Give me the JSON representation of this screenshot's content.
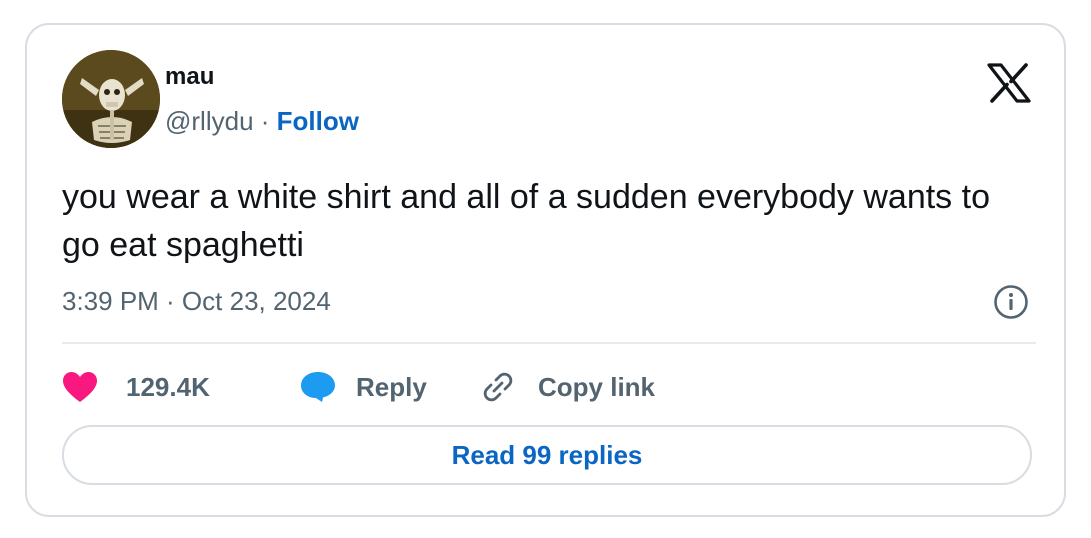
{
  "author": {
    "name": "mau",
    "handle": "@rllydu",
    "separator": "·",
    "follow_label": "Follow"
  },
  "post": {
    "text": "you wear a white shirt and all of a sudden everybody wants to go eat spaghetti",
    "timestamp": "3:39 PM · Oct 23, 2024"
  },
  "actions": {
    "likes": "129.4K",
    "reply_label": "Reply",
    "copy_label": "Copy link"
  },
  "footer": {
    "read_replies_label": "Read 99 replies"
  },
  "icons": {
    "logo": "x-logo-icon",
    "info": "info-icon",
    "like": "heart-icon",
    "reply": "speech-bubble-icon",
    "copy": "link-icon"
  },
  "colors": {
    "heart": "#f91880",
    "reply_bubble": "#1d9bf0",
    "link_blue": "#0a66c2",
    "muted_text": "#536471"
  }
}
